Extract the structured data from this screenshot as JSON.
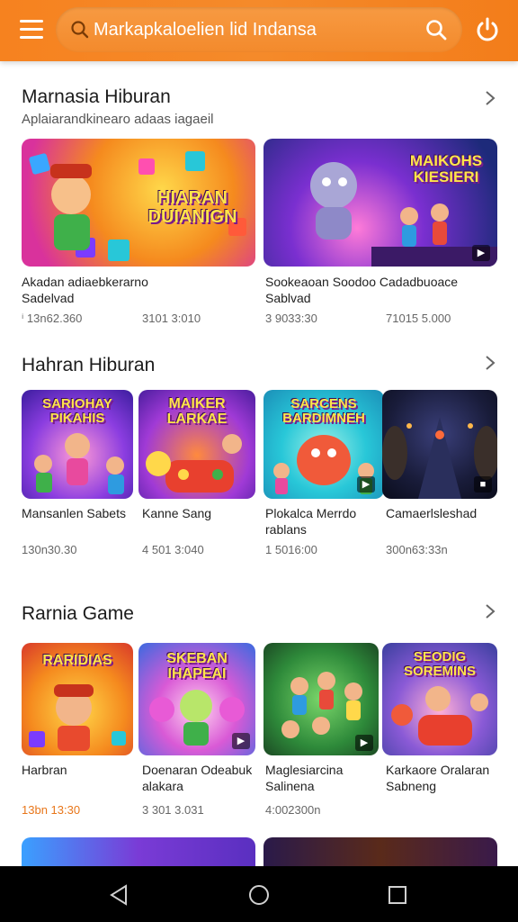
{
  "search": {
    "placeholder": "Markapkaloelien lid Indansa"
  },
  "sections": [
    {
      "title": "Marnasia Hiburan",
      "subtitle": "Aplaiarandkinearo adaas iagaeil",
      "cards": [
        {
          "thumb_text": "HIARAN DUIANIGN",
          "title_line1": "Akadan adiaebkerarno",
          "title_line2": "Sadelvad",
          "stat_a": "ⁱ 13n62.360",
          "stat_b": "3101 3:010"
        },
        {
          "thumb_text": "MAIKOHS KIESIERI",
          "title_line1": "Sookeaoan Soodoo Cadadbuoace",
          "title_line2": "Sablvad",
          "stat_a": "3 9033:30",
          "stat_b": "71015 5.000"
        }
      ]
    },
    {
      "title": "Hahran Hiburan",
      "cards": [
        {
          "thumb_text": "SARIOHAY PIKAHIS",
          "title_line1": "Mansanlen Sabets",
          "title_line2": "",
          "stat_a": "130n30.30",
          "stat_b": ""
        },
        {
          "thumb_text": "MAIKER LARKAE",
          "title_line1": "Kanne Sang",
          "title_line2": "",
          "stat_a": "4 501 3:040",
          "stat_b": ""
        },
        {
          "thumb_text": "SARCENS BARDIMNEH",
          "title_line1": "Plokalca Merrdo",
          "title_line2": "rablans",
          "stat_a": "1 5016:00",
          "stat_b": ""
        },
        {
          "thumb_text": "",
          "title_line1": "Camaerlsleshad",
          "title_line2": "",
          "stat_a": "300n63:33n",
          "stat_b": ""
        }
      ]
    },
    {
      "title": "Rarnia Game",
      "cards": [
        {
          "thumb_text": "RARIDIAS",
          "title_line1": "Harbran",
          "title_line2": "",
          "stat_a": "13bn 13:30",
          "stat_b": ""
        },
        {
          "thumb_text": "SKEBAN IHAPEAI",
          "title_line1": "Doenaran Odeabuk",
          "title_line2": "alakara",
          "stat_a": "3 301 3.031",
          "stat_b": ""
        },
        {
          "thumb_text": "",
          "title_line1": "Maglesiarcina",
          "title_line2": "Salinena",
          "stat_a": "4:002300n",
          "stat_b": ""
        },
        {
          "thumb_text": "SEODIG SOREMINS",
          "title_line1": "Karkaore Oralaran",
          "title_line2": "Sabneng",
          "stat_a": "",
          "stat_b": ""
        }
      ]
    }
  ],
  "colors": {
    "accent": "#f5821f",
    "highlight_stat": "#e8761a"
  }
}
